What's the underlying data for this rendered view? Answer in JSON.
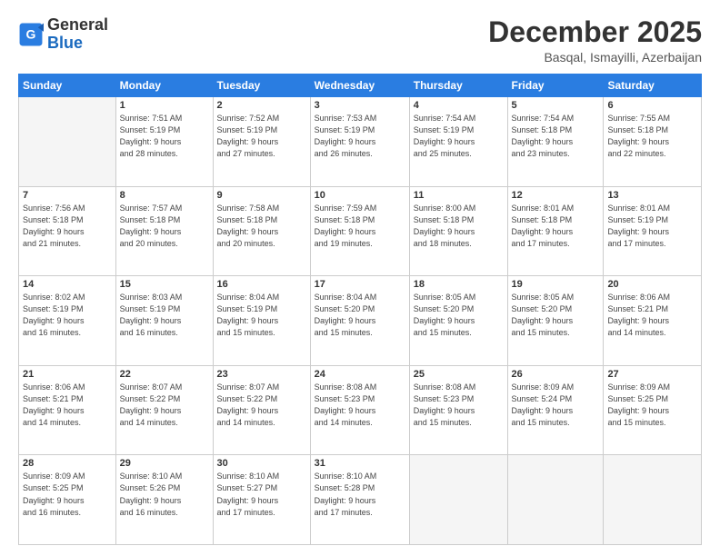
{
  "header": {
    "logo_line1": "General",
    "logo_line2": "Blue",
    "month_title": "December 2025",
    "location": "Basqal, Ismayilli, Azerbaijan"
  },
  "days_of_week": [
    "Sunday",
    "Monday",
    "Tuesday",
    "Wednesday",
    "Thursday",
    "Friday",
    "Saturday"
  ],
  "weeks": [
    [
      {
        "day": "",
        "info": ""
      },
      {
        "day": "1",
        "info": "Sunrise: 7:51 AM\nSunset: 5:19 PM\nDaylight: 9 hours\nand 28 minutes."
      },
      {
        "day": "2",
        "info": "Sunrise: 7:52 AM\nSunset: 5:19 PM\nDaylight: 9 hours\nand 27 minutes."
      },
      {
        "day": "3",
        "info": "Sunrise: 7:53 AM\nSunset: 5:19 PM\nDaylight: 9 hours\nand 26 minutes."
      },
      {
        "day": "4",
        "info": "Sunrise: 7:54 AM\nSunset: 5:19 PM\nDaylight: 9 hours\nand 25 minutes."
      },
      {
        "day": "5",
        "info": "Sunrise: 7:54 AM\nSunset: 5:18 PM\nDaylight: 9 hours\nand 23 minutes."
      },
      {
        "day": "6",
        "info": "Sunrise: 7:55 AM\nSunset: 5:18 PM\nDaylight: 9 hours\nand 22 minutes."
      }
    ],
    [
      {
        "day": "7",
        "info": "Sunrise: 7:56 AM\nSunset: 5:18 PM\nDaylight: 9 hours\nand 21 minutes."
      },
      {
        "day": "8",
        "info": "Sunrise: 7:57 AM\nSunset: 5:18 PM\nDaylight: 9 hours\nand 20 minutes."
      },
      {
        "day": "9",
        "info": "Sunrise: 7:58 AM\nSunset: 5:18 PM\nDaylight: 9 hours\nand 20 minutes."
      },
      {
        "day": "10",
        "info": "Sunrise: 7:59 AM\nSunset: 5:18 PM\nDaylight: 9 hours\nand 19 minutes."
      },
      {
        "day": "11",
        "info": "Sunrise: 8:00 AM\nSunset: 5:18 PM\nDaylight: 9 hours\nand 18 minutes."
      },
      {
        "day": "12",
        "info": "Sunrise: 8:01 AM\nSunset: 5:18 PM\nDaylight: 9 hours\nand 17 minutes."
      },
      {
        "day": "13",
        "info": "Sunrise: 8:01 AM\nSunset: 5:19 PM\nDaylight: 9 hours\nand 17 minutes."
      }
    ],
    [
      {
        "day": "14",
        "info": "Sunrise: 8:02 AM\nSunset: 5:19 PM\nDaylight: 9 hours\nand 16 minutes."
      },
      {
        "day": "15",
        "info": "Sunrise: 8:03 AM\nSunset: 5:19 PM\nDaylight: 9 hours\nand 16 minutes."
      },
      {
        "day": "16",
        "info": "Sunrise: 8:04 AM\nSunset: 5:19 PM\nDaylight: 9 hours\nand 15 minutes."
      },
      {
        "day": "17",
        "info": "Sunrise: 8:04 AM\nSunset: 5:20 PM\nDaylight: 9 hours\nand 15 minutes."
      },
      {
        "day": "18",
        "info": "Sunrise: 8:05 AM\nSunset: 5:20 PM\nDaylight: 9 hours\nand 15 minutes."
      },
      {
        "day": "19",
        "info": "Sunrise: 8:05 AM\nSunset: 5:20 PM\nDaylight: 9 hours\nand 15 minutes."
      },
      {
        "day": "20",
        "info": "Sunrise: 8:06 AM\nSunset: 5:21 PM\nDaylight: 9 hours\nand 14 minutes."
      }
    ],
    [
      {
        "day": "21",
        "info": "Sunrise: 8:06 AM\nSunset: 5:21 PM\nDaylight: 9 hours\nand 14 minutes."
      },
      {
        "day": "22",
        "info": "Sunrise: 8:07 AM\nSunset: 5:22 PM\nDaylight: 9 hours\nand 14 minutes."
      },
      {
        "day": "23",
        "info": "Sunrise: 8:07 AM\nSunset: 5:22 PM\nDaylight: 9 hours\nand 14 minutes."
      },
      {
        "day": "24",
        "info": "Sunrise: 8:08 AM\nSunset: 5:23 PM\nDaylight: 9 hours\nand 14 minutes."
      },
      {
        "day": "25",
        "info": "Sunrise: 8:08 AM\nSunset: 5:23 PM\nDaylight: 9 hours\nand 15 minutes."
      },
      {
        "day": "26",
        "info": "Sunrise: 8:09 AM\nSunset: 5:24 PM\nDaylight: 9 hours\nand 15 minutes."
      },
      {
        "day": "27",
        "info": "Sunrise: 8:09 AM\nSunset: 5:25 PM\nDaylight: 9 hours\nand 15 minutes."
      }
    ],
    [
      {
        "day": "28",
        "info": "Sunrise: 8:09 AM\nSunset: 5:25 PM\nDaylight: 9 hours\nand 16 minutes."
      },
      {
        "day": "29",
        "info": "Sunrise: 8:10 AM\nSunset: 5:26 PM\nDaylight: 9 hours\nand 16 minutes."
      },
      {
        "day": "30",
        "info": "Sunrise: 8:10 AM\nSunset: 5:27 PM\nDaylight: 9 hours\nand 17 minutes."
      },
      {
        "day": "31",
        "info": "Sunrise: 8:10 AM\nSunset: 5:28 PM\nDaylight: 9 hours\nand 17 minutes."
      },
      {
        "day": "",
        "info": ""
      },
      {
        "day": "",
        "info": ""
      },
      {
        "day": "",
        "info": ""
      }
    ]
  ]
}
